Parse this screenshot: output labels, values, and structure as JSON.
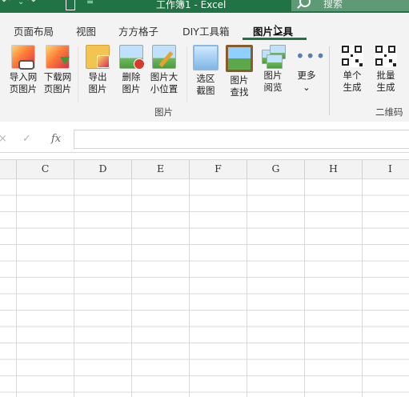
{
  "titlebar": {
    "title": "工作簿1  -  Excel",
    "search_placeholder": "搜索",
    "accent": "#217346"
  },
  "tabs": [
    {
      "label": "页面布局"
    },
    {
      "label": "视图"
    },
    {
      "label": "方方格子"
    },
    {
      "label": "DIY工具箱"
    },
    {
      "label": "图片工具",
      "active": true
    }
  ],
  "ribbon": {
    "groups": {
      "picture": "图片",
      "qrcode": "二维码"
    },
    "buttons": [
      {
        "line1": "导入网",
        "line2": "页图片",
        "icon": "import-web-image-icon"
      },
      {
        "line1": "下载网",
        "line2": "页图片",
        "icon": "download-web-image-icon"
      },
      {
        "line1": "导出",
        "line2": "图片",
        "icon": "export-image-icon"
      },
      {
        "line1": "删除",
        "line2": "图片",
        "icon": "delete-image-icon"
      },
      {
        "line1": "图片大",
        "line2": "小位置",
        "icon": "image-size-position-icon"
      },
      {
        "line1": "选区",
        "line2": "截图",
        "icon": "selection-screenshot-icon"
      },
      {
        "line1": "图片",
        "line2": "查找",
        "icon": "image-find-icon"
      },
      {
        "line1": "图片",
        "line2": "阅览",
        "icon": "image-browse-icon"
      },
      {
        "line1": "更多",
        "line2": "⌄",
        "icon": "more-icon"
      },
      {
        "line1": "单个",
        "line2": "生成",
        "icon": "qr-single-icon"
      },
      {
        "line1": "批量",
        "line2": "生成",
        "icon": "qr-batch-icon"
      }
    ]
  },
  "formula_bar": {
    "cancel": "×",
    "confirm": "✓",
    "fx": "fx",
    "value": ""
  },
  "columns": [
    "C",
    "D",
    "E",
    "F",
    "G",
    "H",
    "I"
  ]
}
